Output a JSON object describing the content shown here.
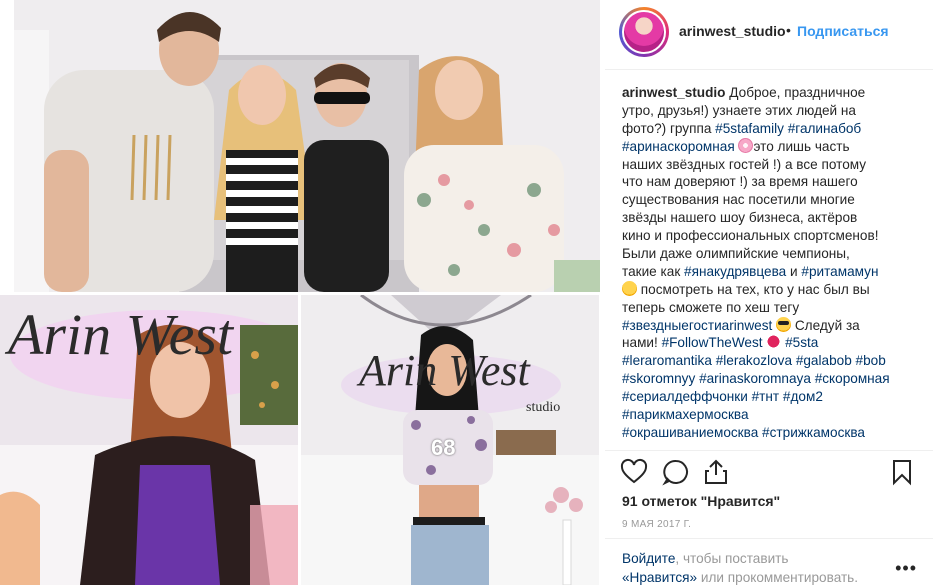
{
  "post": {
    "username": "arinwest_studio",
    "separator": "•",
    "follow_label": "Подписаться"
  },
  "caption": {
    "lines": [
      [
        {
          "t": "u",
          "v": "arinwest_studio"
        },
        {
          "t": "x",
          "v": " Доброе, праздничное"
        }
      ],
      [
        {
          "t": "x",
          "v": "утро, друзья!) узнаете этих людей на"
        }
      ],
      [
        {
          "t": "x",
          "v": "фото?) группа "
        },
        {
          "t": "h",
          "v": "#5stafamily"
        },
        {
          "t": "x",
          "v": " "
        },
        {
          "t": "h",
          "v": "#галинабоб"
        }
      ],
      [
        {
          "t": "h",
          "v": "#аринаскоромная"
        },
        {
          "t": "x",
          "v": " "
        },
        {
          "t": "e",
          "v": "flower"
        },
        {
          "t": "x",
          "v": "это лишь часть"
        }
      ],
      [
        {
          "t": "x",
          "v": "наших звёздных гостей !) а все потому"
        }
      ],
      [
        {
          "t": "x",
          "v": "что нам доверяют !) за время нашего"
        }
      ],
      [
        {
          "t": "x",
          "v": "существования нас посетили многие"
        }
      ],
      [
        {
          "t": "x",
          "v": "звёзды нашего шоу бизнеса, актёров"
        }
      ],
      [
        {
          "t": "x",
          "v": "кино и профессиональных спортсменов!"
        }
      ],
      [
        {
          "t": "x",
          "v": "Были даже олимпийские чемпионы,"
        }
      ],
      [
        {
          "t": "x",
          "v": "такие как "
        },
        {
          "t": "h",
          "v": "#янакудрявцева"
        },
        {
          "t": "x",
          "v": " и "
        },
        {
          "t": "h",
          "v": "#ритамамун"
        }
      ],
      [
        {
          "t": "e",
          "v": "smile"
        },
        {
          "t": "x",
          "v": " посмотреть на тех, кто у нас был вы"
        }
      ],
      [
        {
          "t": "x",
          "v": "теперь сможете по хеш тегу"
        }
      ],
      [
        {
          "t": "h",
          "v": "#звездныегостиarinwest"
        },
        {
          "t": "x",
          "v": " "
        },
        {
          "t": "e",
          "v": "cool"
        },
        {
          "t": "x",
          "v": " Следуй за"
        }
      ],
      [
        {
          "t": "x",
          "v": "нами! "
        },
        {
          "t": "h",
          "v": "#FollowTheWest"
        },
        {
          "t": "x",
          "v": " "
        },
        {
          "t": "e",
          "v": "kiss"
        },
        {
          "t": "x",
          "v": " "
        },
        {
          "t": "h",
          "v": "#5sta"
        }
      ],
      [
        {
          "t": "h",
          "v": "#leraromantika"
        },
        {
          "t": "x",
          "v": " "
        },
        {
          "t": "h",
          "v": "#lerakozlova"
        },
        {
          "t": "x",
          "v": " "
        },
        {
          "t": "h",
          "v": "#galabob"
        },
        {
          "t": "x",
          "v": " "
        },
        {
          "t": "h",
          "v": "#bob"
        }
      ],
      [
        {
          "t": "h",
          "v": "#skoromnyy"
        },
        {
          "t": "x",
          "v": " "
        },
        {
          "t": "h",
          "v": "#arinaskoromnaya"
        },
        {
          "t": "x",
          "v": " "
        },
        {
          "t": "h",
          "v": "#скоромная"
        }
      ],
      [
        {
          "t": "h",
          "v": "#сериалдеффчонки"
        },
        {
          "t": "x",
          "v": " "
        },
        {
          "t": "h",
          "v": "#тнт"
        },
        {
          "t": "x",
          "v": " "
        },
        {
          "t": "h",
          "v": "#дом2"
        }
      ],
      [
        {
          "t": "h",
          "v": "#парикмахермосква"
        }
      ],
      [
        {
          "t": "h",
          "v": "#окрашиваниемосква"
        },
        {
          "t": "x",
          "v": " "
        },
        {
          "t": "h",
          "v": "#стрижкамосква"
        }
      ]
    ]
  },
  "photos": {
    "left_sign": "Arin West",
    "right_sign": "Arin West",
    "right_sign_sub": "studio",
    "shirt_number": "68"
  },
  "actions": {
    "like_icon": "heart-icon",
    "comment_icon": "comment-icon",
    "share_icon": "share-icon",
    "save_icon": "bookmark-icon"
  },
  "likes_text": "91 отметок \"Нравится\"",
  "date_text": "9 МАЯ 2017 Г.",
  "login": {
    "link1": "Войдите",
    "text1": ", чтобы поставить",
    "link2": "«Нравится»",
    "text2": " или прокомментировать.",
    "more_icon": "more-options-icon",
    "more_label": "•••"
  },
  "colors": {
    "link": "#003569",
    "follow": "#3897f0",
    "muted": "#999999",
    "text": "#262626"
  }
}
